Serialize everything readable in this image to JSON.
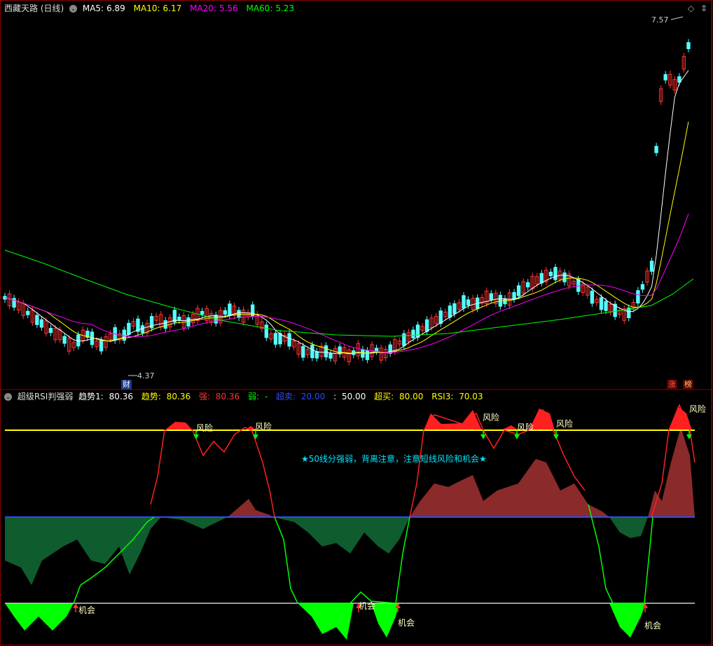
{
  "main_panel": {
    "title": "西藏天路 (日线)",
    "ma": [
      {
        "label": "MA5:",
        "value": "6.89",
        "color": "#ffffff"
      },
      {
        "label": "MA10:",
        "value": "6.17",
        "color": "#ffff00"
      },
      {
        "label": "MA20:",
        "value": "5.56",
        "color": "#ff00ff"
      },
      {
        "label": "MA60:",
        "value": "5.23",
        "color": "#00ff00"
      }
    ],
    "high_label": "7.57",
    "low_label": "4.37",
    "tag_cai": "财",
    "tag_zhang": "涨",
    "tag_bang": "榜"
  },
  "indicator_panel": {
    "title": "超级RSI判强弱",
    "legend": [
      {
        "label": "趋势1:",
        "value": "80.36",
        "color": "#ffffff"
      },
      {
        "label": "趋势:",
        "value": "80.36",
        "color": "#ffff00"
      },
      {
        "label": "强:",
        "value": "80.36",
        "color": "#ff3333"
      },
      {
        "label": "弱:",
        "value": "-",
        "color": "#00ff00"
      },
      {
        "label": "超卖:",
        "value": "20.00",
        "color": "#2a4bff"
      },
      {
        "label": ":",
        "value": "50.00",
        "color": "#ffffff"
      },
      {
        "label": "超买:",
        "value": "80.00",
        "color": "#ffff00"
      },
      {
        "label": "RSI3:",
        "value": "70.03",
        "color": "#ffff00"
      }
    ],
    "note": "★50线分强弱，背离注意，注意短线风险和机会★",
    "risk_label": "风险",
    "chance_label": "机会"
  },
  "colors": {
    "up": "#ff3333",
    "down": "#54ffff",
    "ma5": "#ffffff",
    "ma10": "#ffff00",
    "ma20": "#ff00ff",
    "ma60": "#00ff00",
    "overbought": "#ffff00",
    "midline": "#2a4bff",
    "oversold": "#cccccc",
    "frame": "#8b0000"
  }
}
